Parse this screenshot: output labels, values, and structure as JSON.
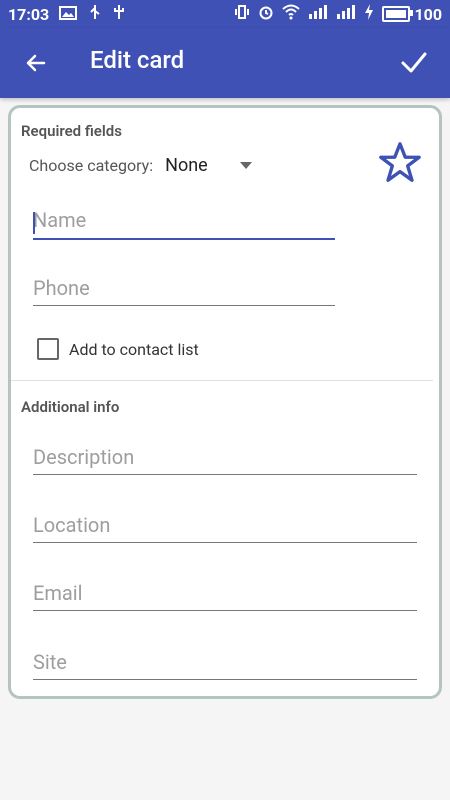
{
  "status_bar": {
    "time": "17:03",
    "battery": "100"
  },
  "app_bar": {
    "title": "Edit card"
  },
  "card": {
    "required_title": "Required fields",
    "choose_label": "Choose category:",
    "choose_value": "None",
    "name_placeholder": "Name",
    "phone_placeholder": "Phone",
    "contact_label": "Add to contact list",
    "additional_title": "Additional info",
    "description_placeholder": "Description",
    "location_placeholder": "Location",
    "email_placeholder": "Email",
    "site_placeholder": "Site"
  },
  "colors": {
    "primary": "#3f51b5",
    "card_border": "#b5c3c1"
  }
}
